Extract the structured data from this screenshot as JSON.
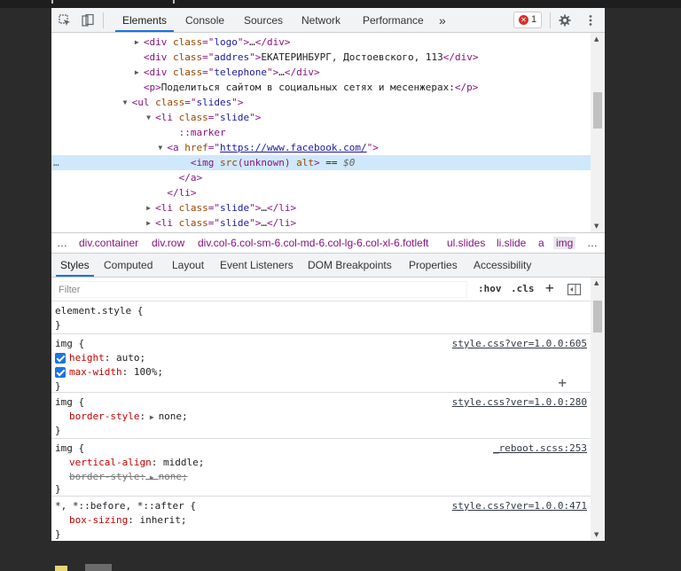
{
  "toolbar": {
    "tabs": [
      "Elements",
      "Console",
      "Sources",
      "Network",
      "Performance"
    ],
    "more": "»",
    "error_count": "1"
  },
  "dom": {
    "lines": [
      {
        "indent": 8,
        "tri": "▶",
        "html": "<span class=\"tg\">&lt;div </span><span class=\"an\">class</span><span class=\"tg\">=\"</span><span class=\"av\">logo</span><span class=\"tg\">\"&gt;</span>…<span class=\"tg\">&lt;/div&gt;</span>"
      },
      {
        "indent": 8,
        "tri": "",
        "html": "<span class=\"tg\">&lt;div </span><span class=\"an\">class</span><span class=\"tg\">=\"</span><span class=\"av\">addres</span><span class=\"tg\">\"&gt;</span>ЕКАТЕРИНБУРГ, Достоевского, 113<span class=\"tg\">&lt;/div&gt;</span>"
      },
      {
        "indent": 8,
        "tri": "▶",
        "html": "<span class=\"tg\">&lt;div </span><span class=\"an\">class</span><span class=\"tg\">=\"</span><span class=\"av\">telephone</span><span class=\"tg\">\"&gt;</span>…<span class=\"tg\">&lt;/div&gt;</span>"
      },
      {
        "indent": 8,
        "tri": "",
        "html": "<span class=\"tg\">&lt;p&gt;</span>Поделиться сайтом в социальных сетях и месенжерах:<span class=\"tg\">&lt;/p&gt;</span>"
      },
      {
        "indent": 7,
        "tri": "▼",
        "html": "<span class=\"tg\">&lt;ul </span><span class=\"an\">class</span><span class=\"tg\">=\"</span><span class=\"av\">slides</span><span class=\"tg\">\"&gt;</span>"
      },
      {
        "indent": 9,
        "tri": "▼",
        "html": "<span class=\"tg\">&lt;li </span><span class=\"an\">class</span><span class=\"tg\">=\"</span><span class=\"av\">slide</span><span class=\"tg\">\"&gt;</span>"
      },
      {
        "indent": 11,
        "tri": "",
        "html": "<span class=\"pseudo\">::marker</span>"
      },
      {
        "indent": 10,
        "tri": "▼",
        "html": "<span class=\"tg\">&lt;a </span><span class=\"an\">href</span><span class=\"tg\">=\"</span><span class=\"lnk\">https://www.facebook.com/</span><span class=\"tg\">\"&gt;</span>"
      },
      {
        "indent": 12,
        "tri": "",
        "sel": true,
        "html": "<span class=\"tg\">&lt;img </span><span class=\"an\">src</span><span class=\"tg\">(unknown) </span><span class=\"an\">alt</span><span class=\"tg\">&gt;</span> == <span class=\"gray\"><i>$0</i></span>"
      },
      {
        "indent": 11,
        "tri": "",
        "html": "<span class=\"tg\">&lt;/a&gt;</span>"
      },
      {
        "indent": 10,
        "tri": "",
        "html": "<span class=\"tg\">&lt;/li&gt;</span>"
      },
      {
        "indent": 9,
        "tri": "▶",
        "html": "<span class=\"tg\">&lt;li </span><span class=\"an\">class</span><span class=\"tg\">=\"</span><span class=\"av\">slide</span><span class=\"tg\">\"&gt;</span>…<span class=\"tg\">&lt;/li&gt;</span>"
      },
      {
        "indent": 9,
        "tri": "▶",
        "html": "<span class=\"tg\">&lt;li </span><span class=\"an\">class</span><span class=\"tg\">=\"</span><span class=\"av\">slide</span><span class=\"tg\">\"&gt;</span>…<span class=\"tg\">&lt;/li&gt;</span>"
      }
    ],
    "ellipsis": "…"
  },
  "breadcrumb": {
    "leading": "…",
    "items": [
      "div.container",
      "div.row",
      "div.col-6.col-sm-6.col-md-6.col-lg-6.col-xl-6.fotleft",
      "ul.slides",
      "li.slide",
      "a",
      "img"
    ],
    "trailing": "…"
  },
  "subtabs": [
    "Styles",
    "Computed",
    "Layout",
    "Event Listeners",
    "DOM Breakpoints",
    "Properties",
    "Accessibility"
  ],
  "filter": {
    "placeholder": "Filter",
    "hov": ":hov",
    "cls": ".cls",
    "plus": "+"
  },
  "styles": {
    "element_style": "element.style {",
    "close": "}",
    "rules": [
      {
        "selector": "img {",
        "source": "style.css?ver=1.0.0:605",
        "props": [
          {
            "name": "height",
            "value": "auto;",
            "checked": true
          },
          {
            "name": "max-width",
            "value": "100%;",
            "checked": true
          }
        ]
      },
      {
        "selector": "img {",
        "source": "style.css?ver=1.0.0:280",
        "props": [
          {
            "name": "border-style",
            "value": "none;",
            "arrow": true
          }
        ]
      },
      {
        "selector": "img {",
        "source": "_reboot.scss:253",
        "props": [
          {
            "name": "vertical-align",
            "value": "middle;"
          },
          {
            "name": "border-style",
            "value": "none;",
            "arrow": true,
            "struck": true
          }
        ]
      },
      {
        "selector": "*, *::before, *::after {",
        "source": "style.css?ver=1.0.0:471",
        "props": [
          {
            "name": "box-sizing",
            "value": "inherit;"
          }
        ]
      }
    ]
  }
}
